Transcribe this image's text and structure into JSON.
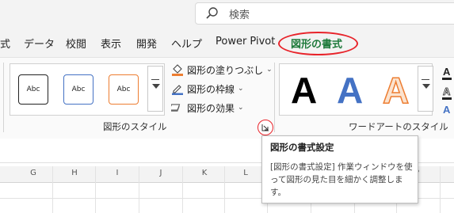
{
  "search": {
    "placeholder": "検索"
  },
  "tabs": [
    {
      "label": "式",
      "active": false
    },
    {
      "label": "データ",
      "active": false
    },
    {
      "label": "校閲",
      "active": false
    },
    {
      "label": "表示",
      "active": false
    },
    {
      "label": "開発",
      "active": false
    },
    {
      "label": "ヘルプ",
      "active": false
    },
    {
      "label": "Power Pivot",
      "active": false
    },
    {
      "label": "図形の書式",
      "active": true
    }
  ],
  "shape_styles": {
    "thumbnails": [
      "Abc",
      "Abc",
      "Abc"
    ],
    "commands": {
      "fill": "図形の塗りつぶし",
      "outline": "図形の枠線",
      "effects": "図形の効果"
    },
    "group_label": "図形のスタイル"
  },
  "wordart_styles": {
    "letters": [
      "A",
      "A",
      "A"
    ],
    "group_label": "ワードアートのスタイル"
  },
  "columns": [
    "G",
    "H",
    "I",
    "J",
    "K",
    "L",
    "",
    "P"
  ],
  "tooltip": {
    "title": "図形の書式設定",
    "body": "[図形の書式設定] 作業ウィンドウを使って図形の見た目を細かく調整します。"
  },
  "colors": {
    "accent_green": "#1e7a3b",
    "annotation_red": "#e8232a",
    "thumb_border_black": "#222222",
    "thumb_border_blue": "#4472c4",
    "thumb_border_orange": "#ed7d31"
  }
}
